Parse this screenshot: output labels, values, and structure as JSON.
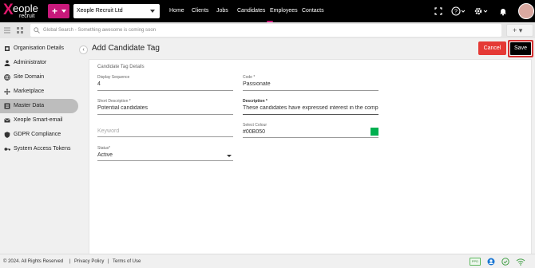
{
  "app": {
    "logo_mark": "X",
    "logo_word": "eople",
    "logo_sub": "recruit",
    "company_select": "Xeople Recruit Ltd",
    "plus_label": "+"
  },
  "nav": {
    "items": [
      "Home",
      "Clients",
      "Jobs",
      "Candidates",
      "Employees",
      "Contacts"
    ],
    "active": "Employees"
  },
  "toolbar_icons": [
    "expand-icon",
    "help-icon",
    "settings-icon",
    "bell-icon",
    "avatar"
  ],
  "search": {
    "placeholder": "Global Search - Something awesome is coming soon",
    "add_label": "+ ▾"
  },
  "sidebar": {
    "items": [
      {
        "label": "Organisation Details",
        "icon": "org-icon"
      },
      {
        "label": "Administrator",
        "icon": "person-icon"
      },
      {
        "label": "Site Domain",
        "icon": "globe-icon"
      },
      {
        "label": "Marketplace",
        "icon": "move-icon"
      },
      {
        "label": "Master Data",
        "icon": "list-icon",
        "active": true
      },
      {
        "label": "Xeople Smart-email",
        "icon": "mail-icon"
      },
      {
        "label": "GDPR Compliance",
        "icon": "shield-icon"
      },
      {
        "label": "System Access Tokens",
        "icon": "key-icon"
      }
    ],
    "collapse_glyph": "‹"
  },
  "page": {
    "title": "Add Candidate Tag",
    "cancel_label": "Cancel",
    "save_label": "Save"
  },
  "form": {
    "section_title": "Candidate Tag Details",
    "display_sequence": {
      "label": "Display Sequence",
      "value": "4"
    },
    "code": {
      "label": "Code *",
      "value": "Passionate"
    },
    "short_description": {
      "label": "Short Description *",
      "value": "Potential candidates"
    },
    "description": {
      "label": "Description *",
      "value": "These candidates have expressed interest in the company or"
    },
    "keyword": {
      "label": "Keyword",
      "placeholder": "Keyword"
    },
    "select_colour": {
      "label": "Select Colour",
      "value": "#00B050",
      "swatch": "#00B050"
    },
    "status": {
      "label": "Status*",
      "value": "Active"
    }
  },
  "footer": {
    "copyright": "© 2024. All Rights Reserved",
    "sep": "|",
    "privacy": "Privacy Policy",
    "terms": "Terms of Use",
    "ppd": "PPD"
  },
  "colors": {
    "topbar": "#000000",
    "brand": "#C8197B",
    "cancel": "#E53935",
    "save": "#000000",
    "accent_green": "#00B050"
  }
}
